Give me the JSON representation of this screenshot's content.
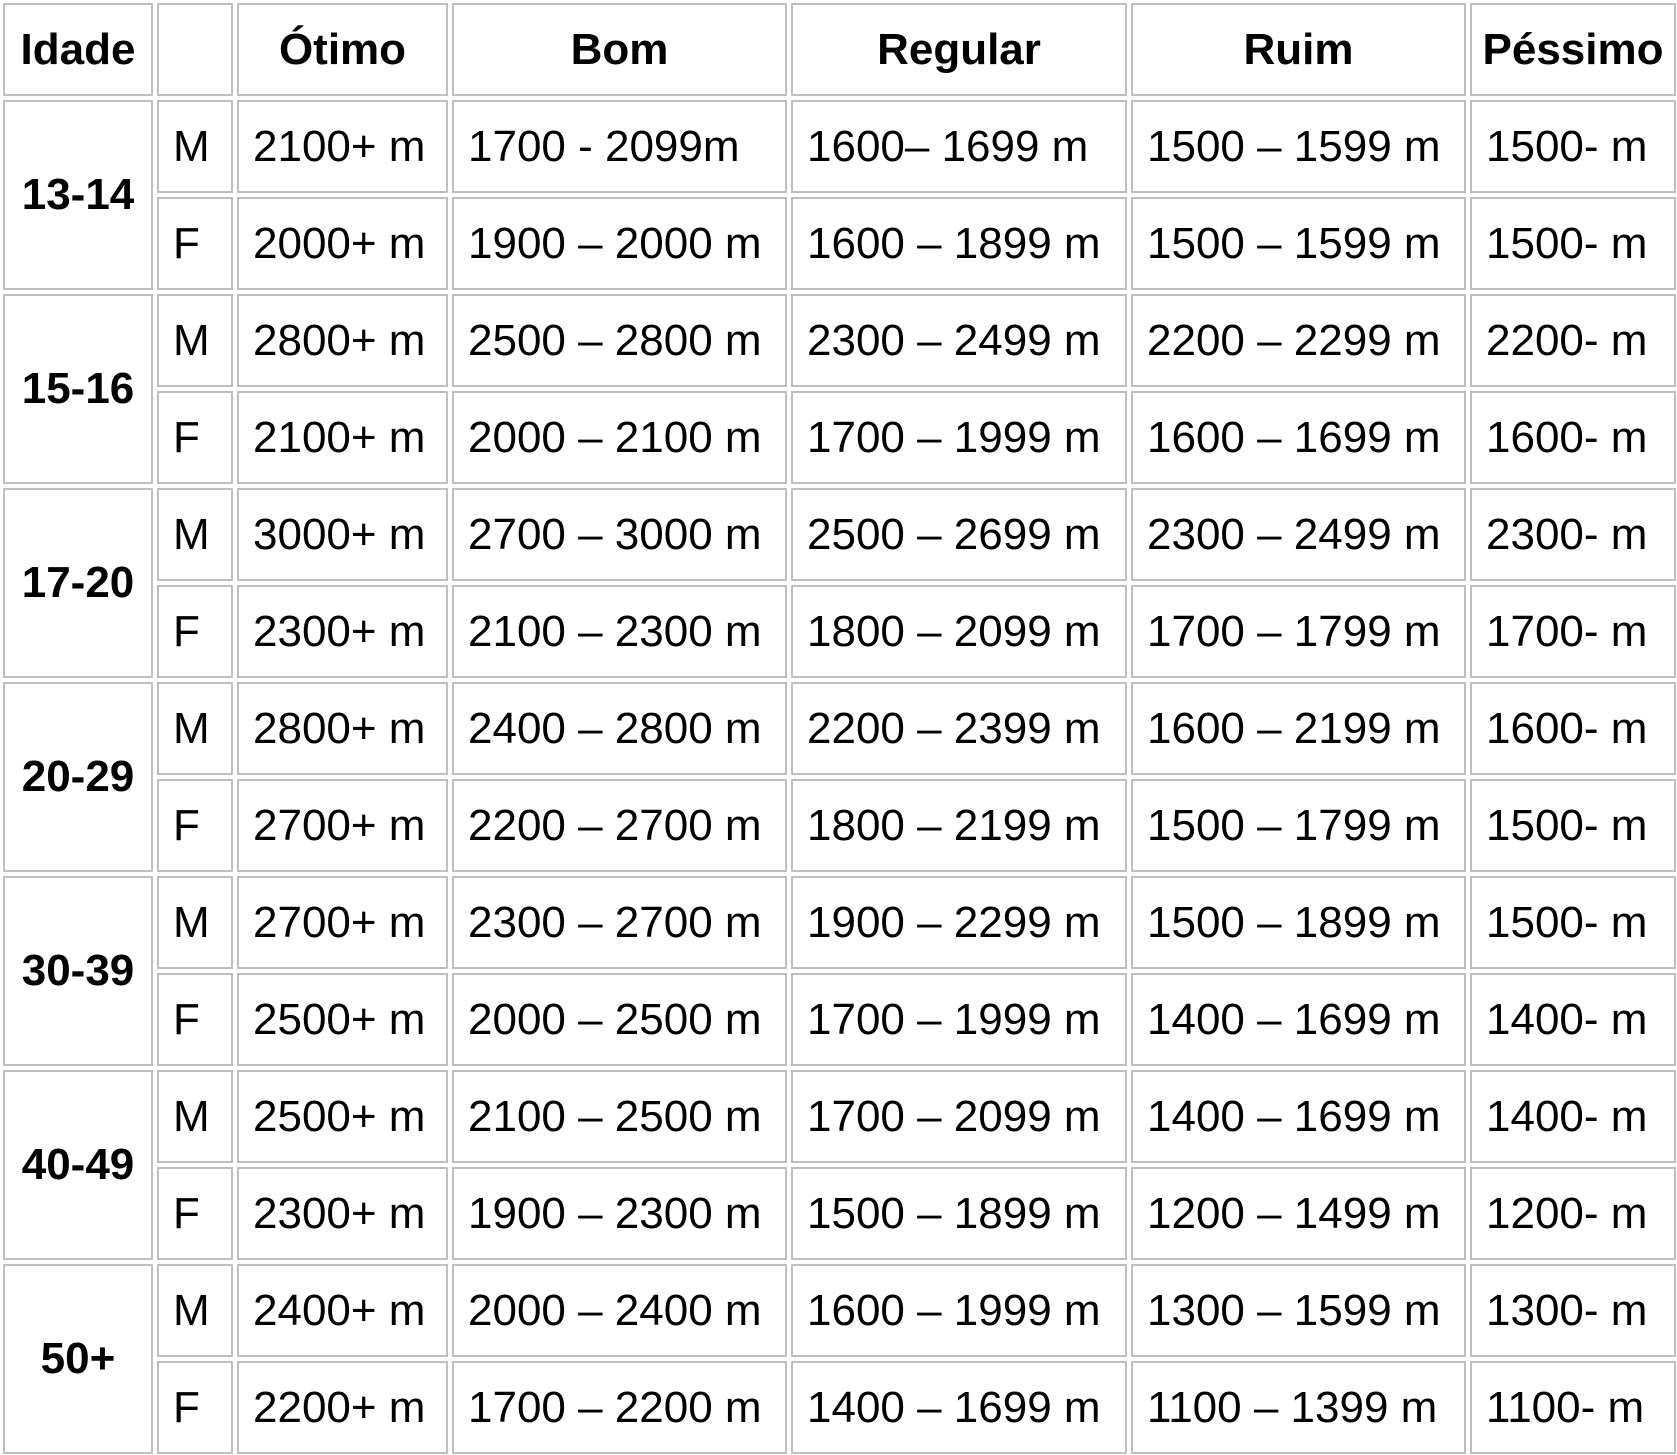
{
  "table": {
    "headers": [
      "Idade",
      "",
      "Ótimo",
      "Bom",
      "Regular",
      "Ruim",
      "Péssimo"
    ],
    "groups": [
      {
        "age": "13-14",
        "rows": [
          {
            "sex": "M",
            "values": [
              "2100+ m",
              "1700 - 2099m",
              "1600– 1699 m",
              "1500 – 1599 m",
              "1500- m"
            ]
          },
          {
            "sex": "F",
            "values": [
              "2000+ m",
              "1900 – 2000 m",
              "1600 – 1899 m",
              "1500 – 1599 m",
              "1500- m"
            ]
          }
        ]
      },
      {
        "age": "15-16",
        "rows": [
          {
            "sex": "M",
            "values": [
              "2800+ m",
              "2500 – 2800 m",
              "2300 – 2499 m",
              "2200 – 2299 m",
              "2200- m"
            ]
          },
          {
            "sex": "F",
            "values": [
              "2100+ m",
              "2000 – 2100 m",
              "1700 – 1999 m",
              "1600 – 1699 m",
              "1600- m"
            ]
          }
        ]
      },
      {
        "age": "17-20",
        "rows": [
          {
            "sex": "M",
            "values": [
              "3000+ m",
              "2700 – 3000 m",
              "2500 – 2699 m",
              "2300 – 2499 m",
              "2300- m"
            ]
          },
          {
            "sex": "F",
            "values": [
              "2300+ m",
              "2100 – 2300 m",
              "1800 – 2099 m",
              "1700 – 1799 m",
              "1700- m"
            ]
          }
        ]
      },
      {
        "age": "20-29",
        "rows": [
          {
            "sex": "M",
            "values": [
              "2800+ m",
              "2400 – 2800 m",
              "2200 – 2399 m",
              "1600 – 2199 m",
              "1600- m"
            ]
          },
          {
            "sex": "F",
            "values": [
              "2700+ m",
              "2200 – 2700 m",
              "1800 – 2199 m",
              "1500 – 1799 m",
              "1500- m"
            ]
          }
        ]
      },
      {
        "age": "30-39",
        "rows": [
          {
            "sex": "M",
            "values": [
              "2700+ m",
              "2300 – 2700 m",
              "1900 – 2299 m",
              "1500 – 1899 m",
              "1500- m"
            ]
          },
          {
            "sex": "F",
            "values": [
              "2500+ m",
              "2000 – 2500 m",
              "1700 – 1999 m",
              "1400 – 1699 m",
              "1400- m"
            ]
          }
        ]
      },
      {
        "age": "40-49",
        "rows": [
          {
            "sex": "M",
            "values": [
              "2500+ m",
              "2100 – 2500 m",
              "1700 – 2099 m",
              "1400 – 1699 m",
              "1400- m"
            ]
          },
          {
            "sex": "F",
            "values": [
              "2300+ m",
              "1900 – 2300 m",
              "1500 – 1899 m",
              "1200 – 1499 m",
              "1200- m"
            ]
          }
        ]
      },
      {
        "age": "50+",
        "rows": [
          {
            "sex": "M",
            "values": [
              "2400+ m",
              "2000 – 2400 m",
              "1600 – 1999 m",
              "1300 – 1599 m",
              "1300- m"
            ]
          },
          {
            "sex": "F",
            "values": [
              "2200+ m",
              "1700 – 2200 m",
              "1400 – 1699 m",
              "1100 – 1399 m",
              "1100- m"
            ]
          }
        ]
      }
    ]
  }
}
